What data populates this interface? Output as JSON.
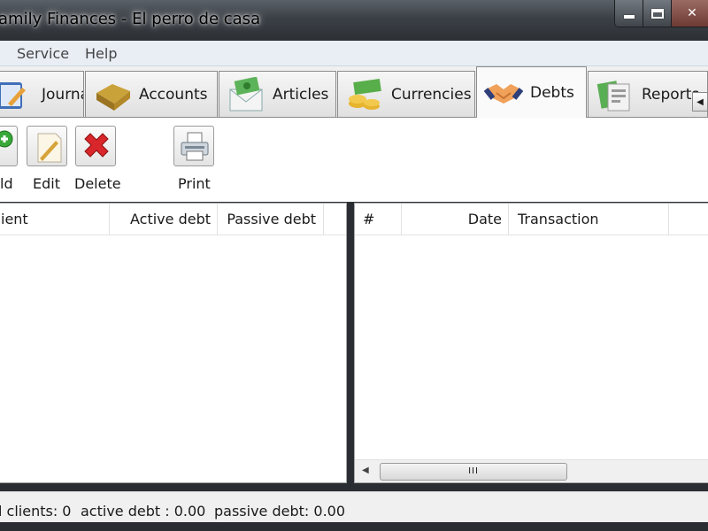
{
  "window": {
    "title": "amily Finances - El perro de casa"
  },
  "menu": [
    {
      "label": "Service"
    },
    {
      "label": "Help"
    }
  ],
  "tabs": [
    {
      "label": "Journal",
      "icon": "journal-icon"
    },
    {
      "label": "Accounts",
      "icon": "wallet-icon"
    },
    {
      "label": "Articles",
      "icon": "money-envelope-icon"
    },
    {
      "label": "Currencies",
      "icon": "coins-icon"
    },
    {
      "label": "Debts",
      "icon": "handshake-icon",
      "active": true
    },
    {
      "label": "Reports",
      "icon": "report-icon"
    }
  ],
  "toolbar": {
    "add_label": "ld",
    "edit_label": "Edit",
    "delete_label": "Delete",
    "print_label": "Print"
  },
  "clients_table": {
    "columns": [
      "ient",
      "Active debt",
      "Passive debt"
    ],
    "rows": []
  },
  "transactions_table": {
    "columns": [
      "#",
      "Date",
      "Transaction"
    ],
    "rows": [],
    "scroll_thumb": "III"
  },
  "status": {
    "clients": "l clients: 0",
    "active_debt": "active debt : 0.00",
    "passive_debt": "passive debt: 0.00"
  },
  "colors": {
    "title_bar": "#3b4046",
    "close_button": "#6e3a33",
    "tab_active": "#fafafa"
  }
}
